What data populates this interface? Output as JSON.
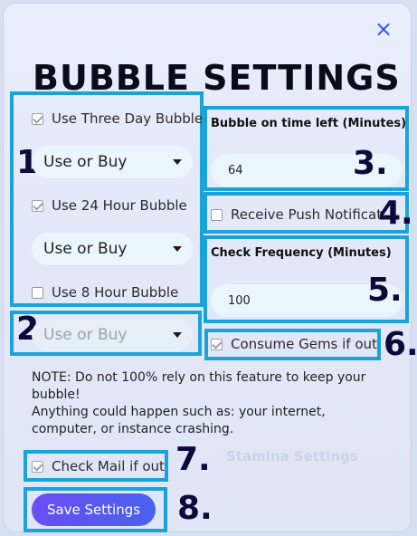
{
  "dialog": {
    "title": "BUBBLE SETTINGS",
    "close_label": "×"
  },
  "left": {
    "three_day": {
      "label": "Use Three Day Bubble",
      "checked": true,
      "select_value": "Use or Buy"
    },
    "twenty_four_hour": {
      "label": "Use 24 Hour Bubble",
      "checked": true,
      "select_value": "Use or Buy"
    },
    "eight_hour": {
      "label": "Use 8 Hour Bubble",
      "checked": false,
      "select_value": "Use or Buy"
    }
  },
  "right": {
    "bubble_time_left": {
      "label": "Bubble on time left (Minutes)",
      "value": "64"
    },
    "push": {
      "label": "Receive Push Notifications",
      "checked": false
    },
    "check_frequency": {
      "label": "Check Frequency (Minutes)",
      "value": "100"
    },
    "consume_gems": {
      "label": "Consume Gems if out",
      "checked": true
    }
  },
  "note": {
    "line1": "NOTE: Do not 100% rely on this feature to keep your bubble!",
    "line2": "Anything could happen such as: your internet, computer, or instance crashing."
  },
  "check_mail": {
    "label": "Check Mail if out",
    "checked": true
  },
  "save_label": "Save Settings",
  "annotations": [
    "1.",
    "2.",
    "3.",
    "4.",
    "5.",
    "6.",
    "7.",
    "8."
  ],
  "colors": {
    "highlight": "#1aa3d9",
    "accent": "#3a56d8",
    "button_gradient_start": "#6a4df3",
    "button_gradient_end": "#4a62ee"
  }
}
